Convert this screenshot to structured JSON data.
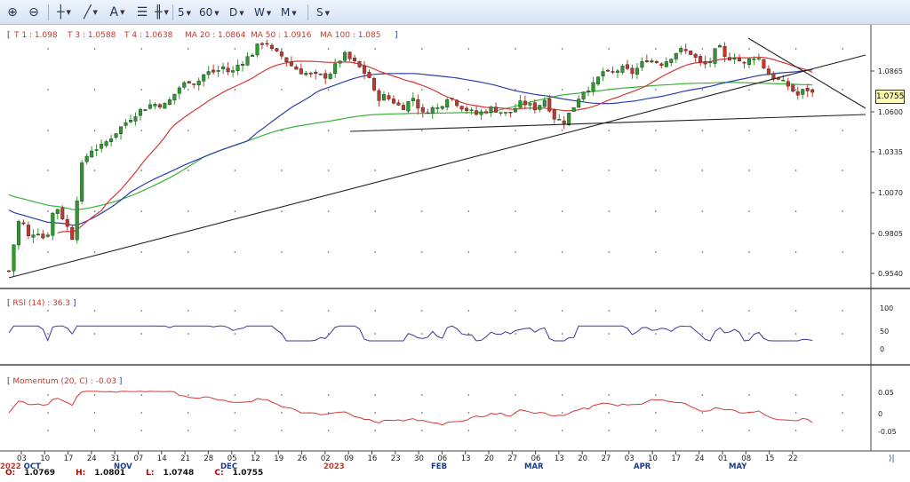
{
  "toolbar": {
    "items": [
      {
        "name": "zoom-in-icon",
        "glyph": "🔍"
      },
      {
        "name": "zoom-out-icon",
        "glyph": "🔍"
      },
      {
        "name": "crosshair-tool-icon",
        "glyph": "┼"
      },
      {
        "name": "line-tool-icon",
        "glyph": "╱"
      },
      {
        "name": "text-tool-icon",
        "glyph": "A"
      },
      {
        "name": "indicator-tool-icon",
        "glyph": "☰"
      },
      {
        "name": "bar-type-icon",
        "glyph": "╫"
      }
    ],
    "timeframes": [
      "5",
      "60",
      "D",
      "W",
      "M"
    ],
    "symbol_menu": "S"
  },
  "main_panel": {
    "legend": [
      {
        "label": "T 1",
        "value": ": 1.098"
      },
      {
        "label": "T 3",
        "value": ": 1.0588"
      },
      {
        "label": "T 4",
        "value": ": 1.0638"
      },
      {
        "label": "MA 20",
        "value": ": 1.0864"
      },
      {
        "label": "MA 50",
        "value": ": 1.0916"
      },
      {
        "label": "MA 100",
        "value": ": 1.085"
      }
    ],
    "price_axis": [
      "1.0865",
      "1.0600",
      "1.0335",
      "1.0070",
      "0.9805",
      "0.9540"
    ],
    "last_price": "1.0755",
    "colors": {
      "up": "#2d9a2d",
      "down": "#c0392b",
      "ma20": "#d43a3a",
      "ma50": "#2d3fa8",
      "ma100": "#3cb33c",
      "trend": "#222222"
    }
  },
  "rsi_panel": {
    "title": "RSI (14) : 36.3",
    "axis": [
      "100",
      "50",
      "0"
    ],
    "color": "#3a3a9a"
  },
  "momentum_panel": {
    "title": "Momentum (20, C) : -0.03",
    "axis": [
      "0.05",
      "0",
      "-0.05"
    ],
    "color": "#d43a3a"
  },
  "time_axis": {
    "days": [
      "03",
      "10",
      "17",
      "24",
      "31",
      "07",
      "14",
      "21",
      "28",
      "05",
      "12",
      "19",
      "26",
      "02",
      "09",
      "16",
      "23",
      "30",
      "06",
      "13",
      "20",
      "27",
      "06",
      "13",
      "20",
      "27",
      "03",
      "10",
      "17",
      "24",
      "01",
      "08",
      "15",
      "22"
    ],
    "months": [
      "2022 OCT",
      "NOV",
      "DEC",
      "2023",
      "FEB",
      "MAR",
      "APR",
      "MAY"
    ]
  },
  "ohlc": {
    "open": "1.0769",
    "high": "1.0801",
    "low": "1.0748",
    "close": "1.0755"
  },
  "scroll_end_label": "⟩|"
}
